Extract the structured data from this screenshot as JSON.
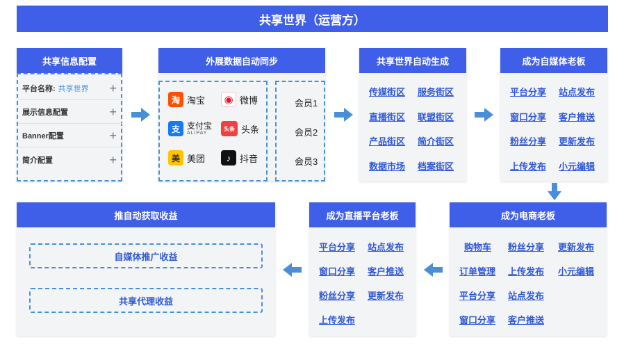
{
  "title": "共享世界（运营方）",
  "config": {
    "header": "共享信息配置",
    "rows": [
      {
        "label": "平台名称:",
        "value": "共享世界"
      },
      {
        "label": "展示信息配置"
      },
      {
        "label": "Banner配置"
      },
      {
        "label": "简介配置"
      }
    ]
  },
  "sync": {
    "header": "外展数据自动同步",
    "platforms": [
      {
        "name": "淘宝",
        "icon": "taobao-icon",
        "glyph": "淘",
        "color": "#ff5000"
      },
      {
        "name": "微博",
        "icon": "weibo-icon",
        "glyph": "◉",
        "color": "#e6162d"
      },
      {
        "name": "支付宝",
        "sub": "ALIPAY",
        "icon": "alipay-icon",
        "glyph": "支",
        "color": "#1677ff"
      },
      {
        "name": "头条",
        "icon": "toutiao-icon",
        "glyph": "头条",
        "color": "#f04142"
      },
      {
        "name": "美团",
        "icon": "meituan-icon",
        "glyph": "美",
        "color": "#ffc300"
      },
      {
        "name": "抖音",
        "icon": "douyin-icon",
        "glyph": "♪",
        "color": "#111111"
      }
    ],
    "members": [
      "会员1",
      "会员2",
      "会员3"
    ]
  },
  "generate": {
    "header": "共享世界自动生成",
    "items": [
      "传媒街区",
      "服务街区",
      "直播街区",
      "联盟街区",
      "产品街区",
      "简介街区",
      "数据市场",
      "档案街区"
    ]
  },
  "media": {
    "header": "成为自媒体老板",
    "items": [
      "平台分享",
      "站点发布",
      "窗口分享",
      "客户推送",
      "粉丝分享",
      "更新发布",
      "上传发布",
      "小元编辑"
    ]
  },
  "ecom": {
    "header": "成为电商老板",
    "items": [
      "购物车",
      "粉丝分享",
      "更新发布",
      "订单管理",
      "上传发布",
      "小元编辑",
      "平台分享",
      "站点发布",
      "窗口分享",
      "客户推送"
    ]
  },
  "live": {
    "header": "成为直播平台老板",
    "items": [
      "平台分享",
      "站点发布",
      "窗口分享",
      "客户推送",
      "粉丝分享",
      "更新发布",
      "上传发布"
    ]
  },
  "income": {
    "header": "推自动获取收益",
    "items": [
      "自媒体推广收益",
      "共享代理收益"
    ]
  },
  "colors": {
    "brand": "#3f5fe8",
    "link": "#2f59d6",
    "dashed": "#4a8fd6",
    "card": "#f3f4f6"
  }
}
